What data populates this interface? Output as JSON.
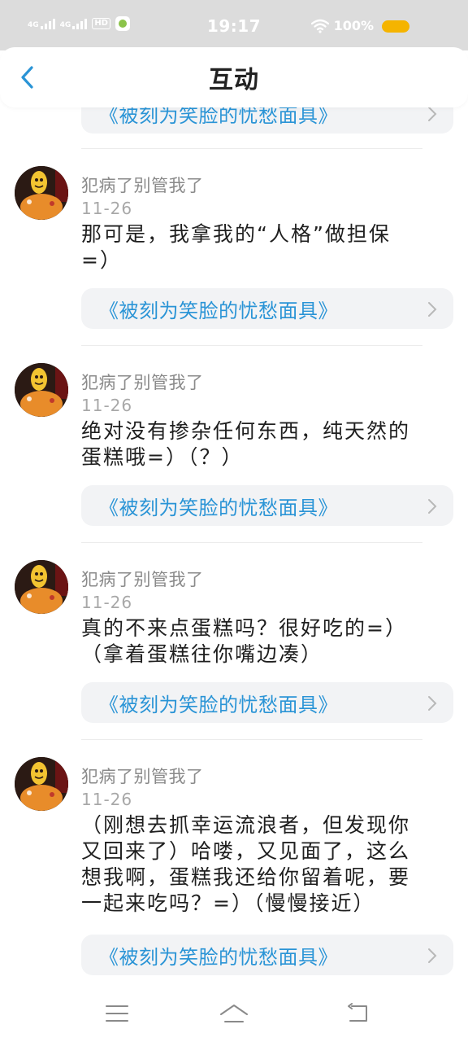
{
  "status_bar": {
    "time": "19:17",
    "battery_text": "100%",
    "net1": "4G",
    "net2": "4G",
    "hd_label": "HD",
    "battery_color": "#f5b400"
  },
  "header": {
    "title": "互动",
    "back_icon": "chevron-left-icon"
  },
  "source_title": "《被刻为笑脸的忧愁面具》",
  "comments": [
    {
      "username": "犯病了别管我了",
      "date": "11-26",
      "lines": [
        "那可是，我拿我的“人格”做担保",
        "=）"
      ]
    },
    {
      "username": "犯病了别管我了",
      "date": "11-26",
      "lines": [
        "绝对没有掺杂任何东西，纯天然的",
        "蛋糕哦=）（？）"
      ]
    },
    {
      "username": "犯病了别管我了",
      "date": "11-26",
      "lines": [
        "真的不来点蛋糕吗？很好吃的=）",
        "（拿着蛋糕往你嘴边凑）"
      ]
    },
    {
      "username": "犯病了别管我了",
      "date": "11-26",
      "lines": [
        "（刚想去抓幸运流浪者，但发现你",
        "又回来了）哈喽，又见面了，这么",
        "想我啊，蛋糕我还给你留着呢，要",
        "一起来吃吗？=）（慢慢接近）"
      ]
    }
  ],
  "colors": {
    "accent": "#2a94d6",
    "card_bg": "#f2f3f5",
    "status_bg": "#dcdcdc"
  },
  "navbar": {
    "icons": [
      "menu-icon",
      "home-icon",
      "back-icon"
    ]
  }
}
